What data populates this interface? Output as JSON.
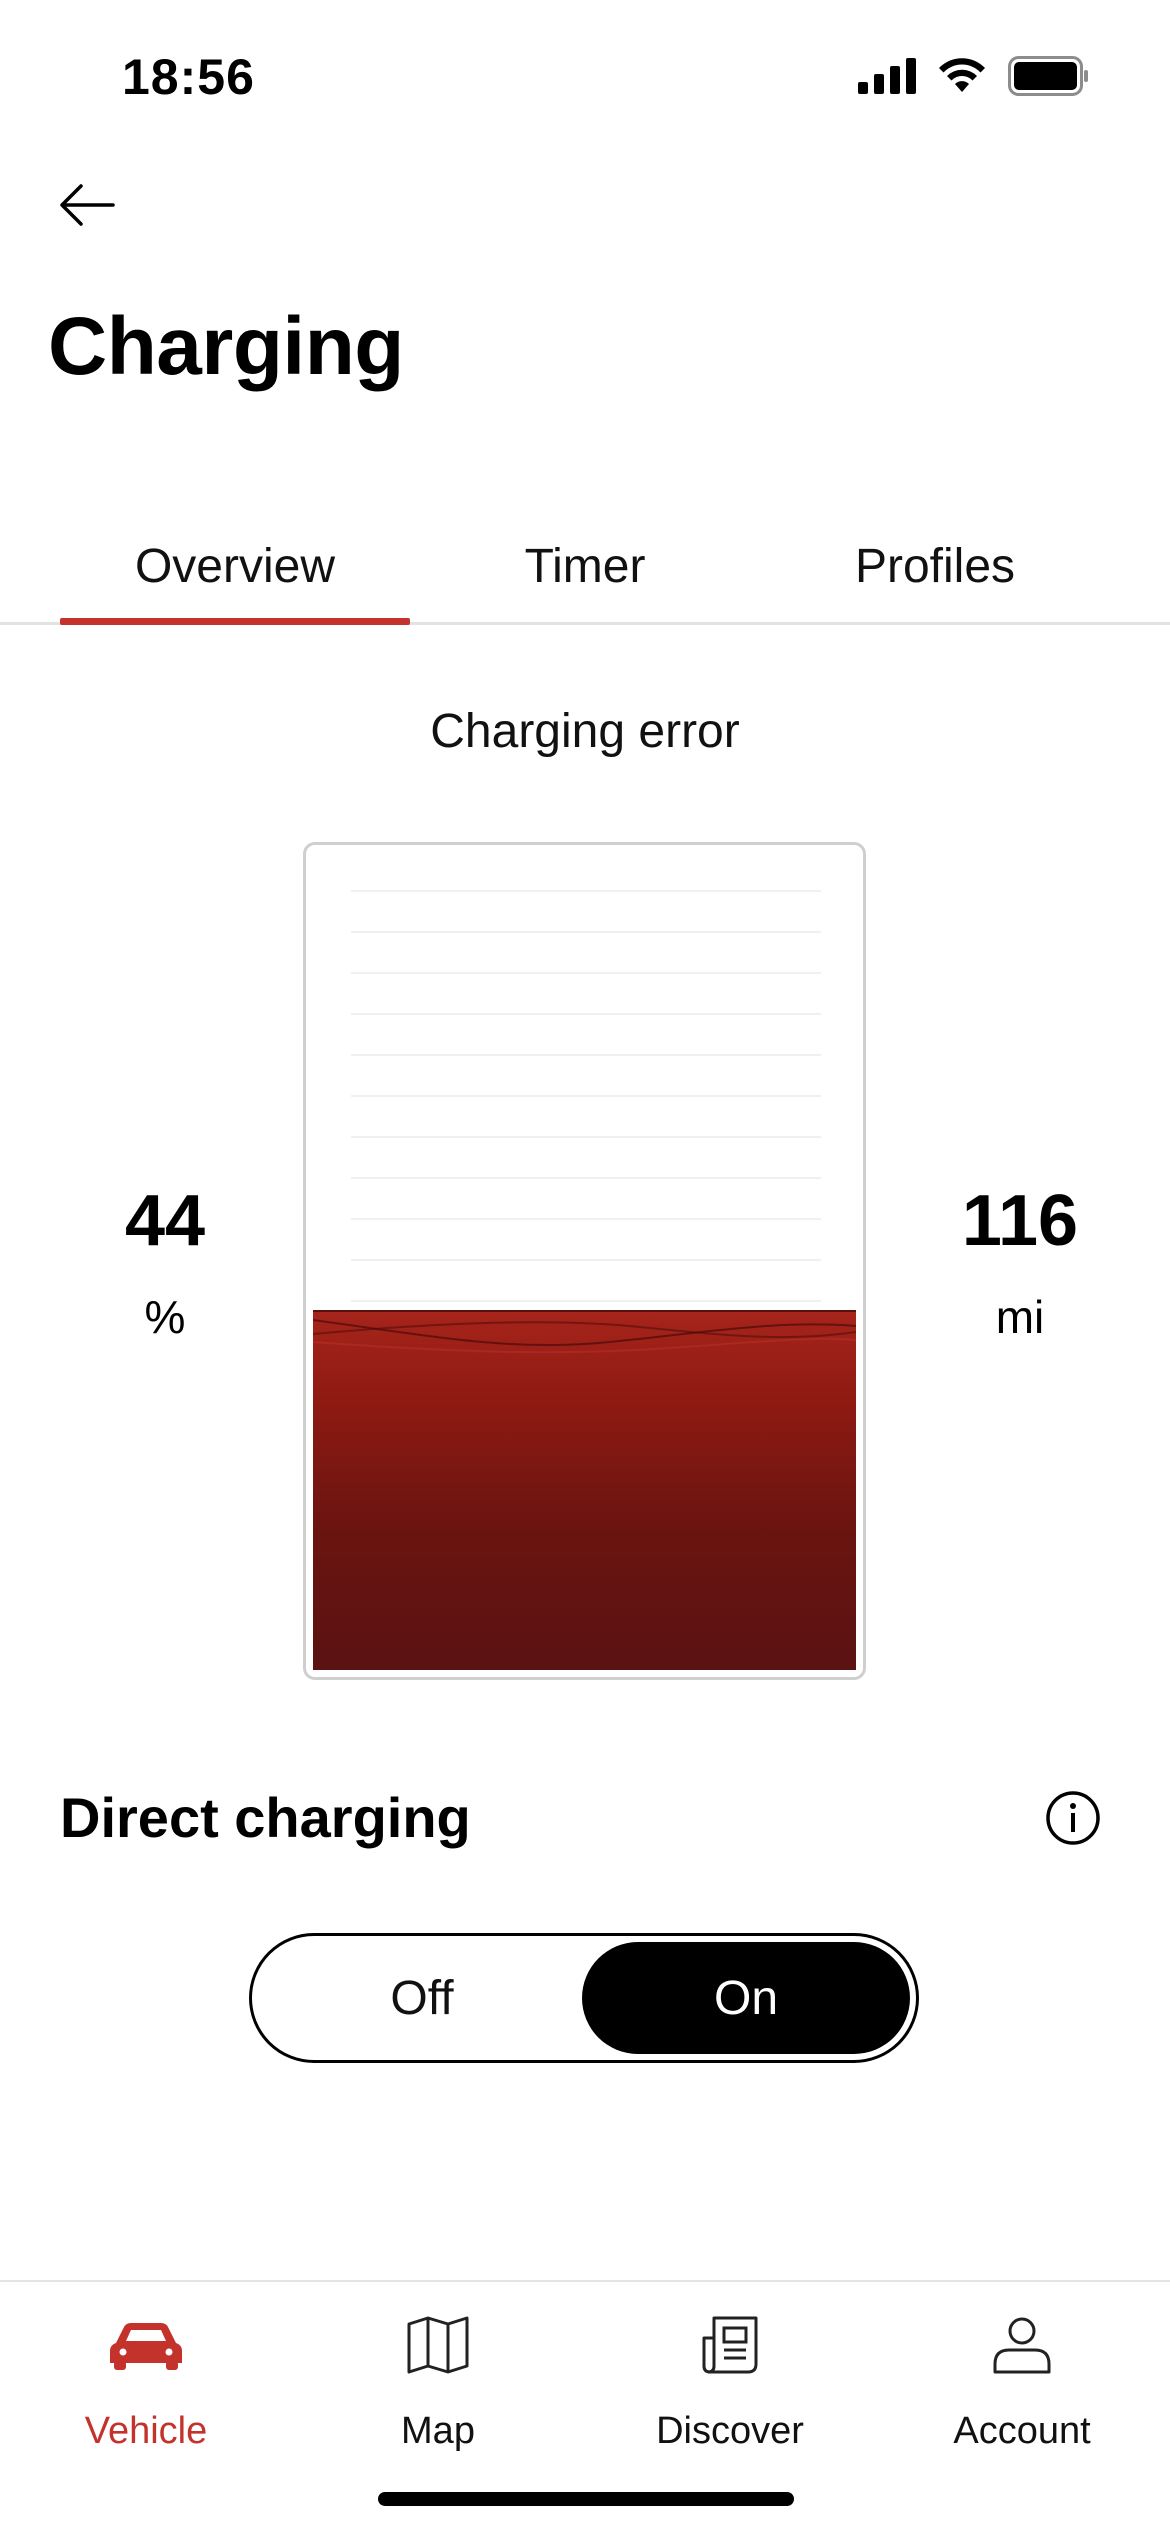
{
  "status_bar": {
    "time": "18:56",
    "icons": [
      "signal-icon",
      "wifi-icon",
      "battery-icon"
    ]
  },
  "header": {
    "back_icon": "arrow-left-icon",
    "title": "Charging"
  },
  "tabs": [
    {
      "label": "Overview",
      "active": true
    },
    {
      "label": "Timer",
      "active": false
    },
    {
      "label": "Profiles",
      "active": false
    }
  ],
  "charging": {
    "status": "Charging error",
    "state_of_charge": 44,
    "state_of_charge_unit": "%",
    "range": 116,
    "range_unit": "mi"
  },
  "direct_charging": {
    "title": "Direct charging",
    "info_icon": "info-icon",
    "options": [
      "Off",
      "On"
    ],
    "selected": "On"
  },
  "bottom_nav": [
    {
      "label": "Vehicle",
      "icon": "car-icon",
      "active": true
    },
    {
      "label": "Map",
      "icon": "map-icon",
      "active": false
    },
    {
      "label": "Discover",
      "icon": "newspaper-icon",
      "active": false
    },
    {
      "label": "Account",
      "icon": "person-icon",
      "active": false
    }
  ],
  "colors": {
    "accent": "#c4332b",
    "fill_dark": "#5a1213",
    "fill_light": "#a6241b"
  }
}
